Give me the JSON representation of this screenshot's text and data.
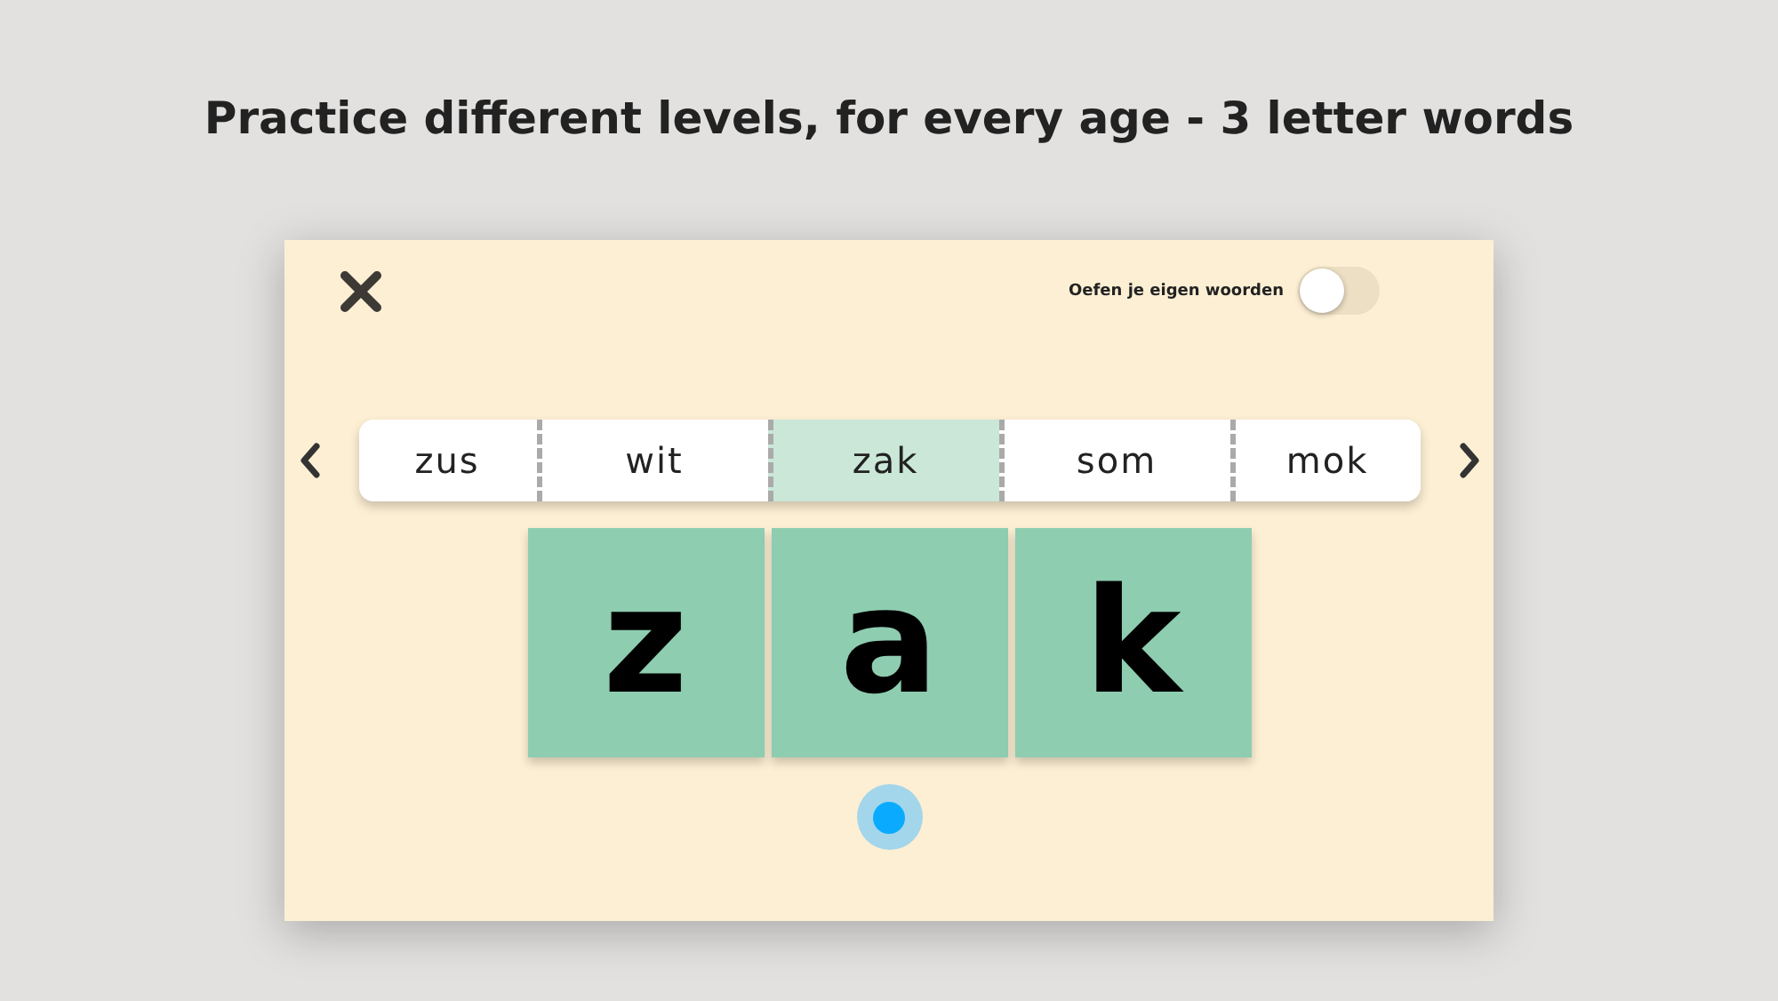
{
  "headline": "Practice different levels, for every age - 3 letter words",
  "toggle": {
    "label": "Oefen je eigen woorden",
    "on": false
  },
  "words": [
    {
      "label": "zus",
      "selected": false
    },
    {
      "label": "wit",
      "selected": false
    },
    {
      "label": "zak",
      "selected": true
    },
    {
      "label": "som",
      "selected": false
    },
    {
      "label": "mok",
      "selected": false
    }
  ],
  "letters": [
    "z",
    "a",
    "k"
  ]
}
